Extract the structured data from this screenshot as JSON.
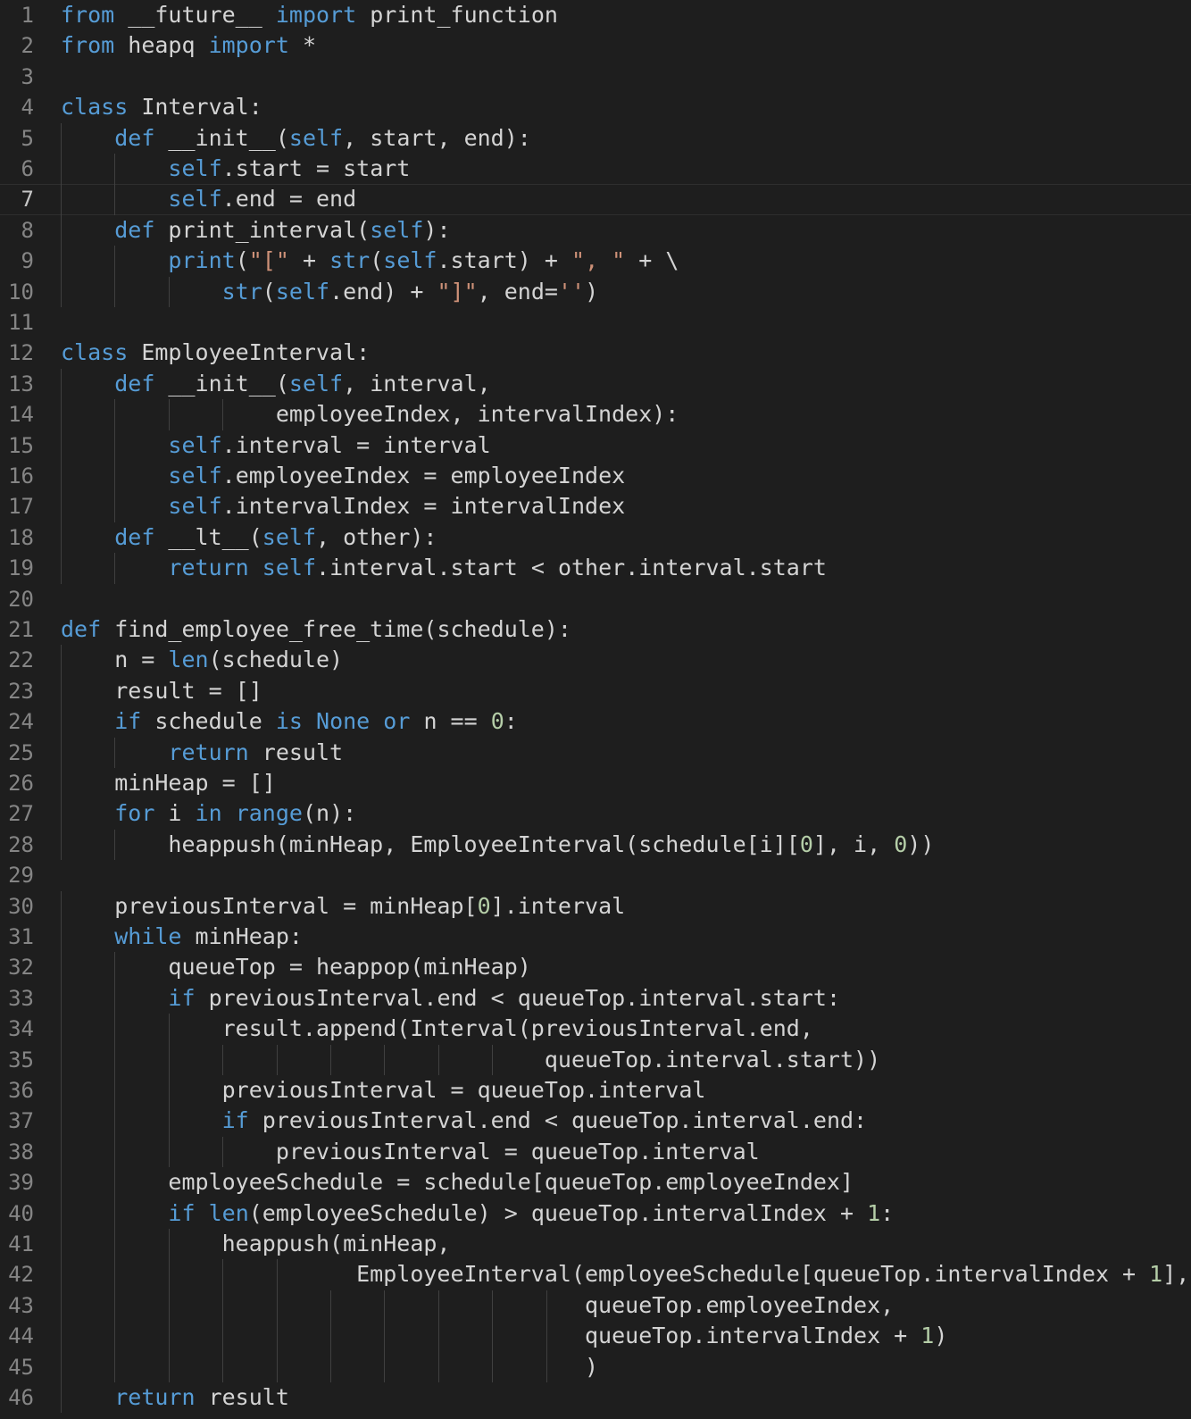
{
  "editor": {
    "language": "python",
    "current_line": 7,
    "colors": {
      "background": "#1e1e1e",
      "line_number": "#858585",
      "keyword": "#569cd6",
      "builtin": "#569cd6",
      "string": "#ce9178",
      "number": "#b5cea8",
      "text": "#d4d4d4",
      "indent_guide": "#404040"
    },
    "lines": [
      {
        "n": "1",
        "indent": 0,
        "tokens": [
          [
            "kw",
            "from"
          ],
          [
            "df",
            " __future__ "
          ],
          [
            "kw",
            "import"
          ],
          [
            "df",
            " print_function"
          ]
        ]
      },
      {
        "n": "2",
        "indent": 0,
        "tokens": [
          [
            "kw",
            "from"
          ],
          [
            "df",
            " heapq "
          ],
          [
            "kw",
            "import"
          ],
          [
            "df",
            " *"
          ]
        ]
      },
      {
        "n": "3",
        "indent": 0,
        "tokens": []
      },
      {
        "n": "4",
        "indent": 0,
        "tokens": [
          [
            "kw",
            "class"
          ],
          [
            "df",
            " Interval:"
          ]
        ]
      },
      {
        "n": "5",
        "indent": 1,
        "tokens": [
          [
            "df",
            "    "
          ],
          [
            "kw",
            "def"
          ],
          [
            "df",
            " __init__("
          ],
          [
            "kw",
            "self"
          ],
          [
            "df",
            ", start, end):"
          ]
        ]
      },
      {
        "n": "6",
        "indent": 2,
        "tokens": [
          [
            "df",
            "        "
          ],
          [
            "kw",
            "self"
          ],
          [
            "df",
            ".start = start"
          ]
        ]
      },
      {
        "n": "7",
        "indent": 2,
        "tokens": [
          [
            "df",
            "        "
          ],
          [
            "kw",
            "self"
          ],
          [
            "df",
            ".end = end"
          ]
        ]
      },
      {
        "n": "8",
        "indent": 1,
        "tokens": [
          [
            "df",
            "    "
          ],
          [
            "kw",
            "def"
          ],
          [
            "df",
            " print_interval("
          ],
          [
            "kw",
            "self"
          ],
          [
            "df",
            "):"
          ]
        ]
      },
      {
        "n": "9",
        "indent": 2,
        "tokens": [
          [
            "df",
            "        "
          ],
          [
            "kw",
            "print"
          ],
          [
            "df",
            "("
          ],
          [
            "st",
            "\"[\""
          ],
          [
            "df",
            " + "
          ],
          [
            "kw",
            "str"
          ],
          [
            "df",
            "("
          ],
          [
            "kw",
            "self"
          ],
          [
            "df",
            ".start) + "
          ],
          [
            "st",
            "\", \""
          ],
          [
            "df",
            " + \\"
          ]
        ]
      },
      {
        "n": "10",
        "indent": 3,
        "tokens": [
          [
            "df",
            "            "
          ],
          [
            "kw",
            "str"
          ],
          [
            "df",
            "("
          ],
          [
            "kw",
            "self"
          ],
          [
            "df",
            ".end) + "
          ],
          [
            "st",
            "\"]\""
          ],
          [
            "df",
            ", end="
          ],
          [
            "st",
            "''"
          ],
          [
            "df",
            ")"
          ]
        ]
      },
      {
        "n": "11",
        "indent": 0,
        "tokens": []
      },
      {
        "n": "12",
        "indent": 0,
        "tokens": [
          [
            "kw",
            "class"
          ],
          [
            "df",
            " EmployeeInterval:"
          ]
        ]
      },
      {
        "n": "13",
        "indent": 1,
        "tokens": [
          [
            "df",
            "    "
          ],
          [
            "kw",
            "def"
          ],
          [
            "df",
            " __init__("
          ],
          [
            "kw",
            "self"
          ],
          [
            "df",
            ", interval,"
          ]
        ]
      },
      {
        "n": "14",
        "indent": 4,
        "tokens": [
          [
            "df",
            "                employeeIndex, intervalIndex):"
          ]
        ]
      },
      {
        "n": "15",
        "indent": 2,
        "tokens": [
          [
            "df",
            "        "
          ],
          [
            "kw",
            "self"
          ],
          [
            "df",
            ".interval = interval"
          ]
        ]
      },
      {
        "n": "16",
        "indent": 2,
        "tokens": [
          [
            "df",
            "        "
          ],
          [
            "kw",
            "self"
          ],
          [
            "df",
            ".employeeIndex = employeeIndex"
          ]
        ]
      },
      {
        "n": "17",
        "indent": 2,
        "tokens": [
          [
            "df",
            "        "
          ],
          [
            "kw",
            "self"
          ],
          [
            "df",
            ".intervalIndex = intervalIndex"
          ]
        ]
      },
      {
        "n": "18",
        "indent": 1,
        "tokens": [
          [
            "df",
            "    "
          ],
          [
            "kw",
            "def"
          ],
          [
            "df",
            " __lt__("
          ],
          [
            "kw",
            "self"
          ],
          [
            "df",
            ", other):"
          ]
        ]
      },
      {
        "n": "19",
        "indent": 2,
        "tokens": [
          [
            "df",
            "        "
          ],
          [
            "kw",
            "return"
          ],
          [
            "df",
            " "
          ],
          [
            "kw",
            "self"
          ],
          [
            "df",
            ".interval.start < other.interval.start"
          ]
        ]
      },
      {
        "n": "20",
        "indent": 0,
        "tokens": []
      },
      {
        "n": "21",
        "indent": 0,
        "tokens": [
          [
            "kw",
            "def"
          ],
          [
            "df",
            " find_employee_free_time(schedule):"
          ]
        ]
      },
      {
        "n": "22",
        "indent": 1,
        "tokens": [
          [
            "df",
            "    n = "
          ],
          [
            "kw",
            "len"
          ],
          [
            "df",
            "(schedule)"
          ]
        ]
      },
      {
        "n": "23",
        "indent": 1,
        "tokens": [
          [
            "df",
            "    result = []"
          ]
        ]
      },
      {
        "n": "24",
        "indent": 1,
        "tokens": [
          [
            "df",
            "    "
          ],
          [
            "kw",
            "if"
          ],
          [
            "df",
            " schedule "
          ],
          [
            "kw",
            "is"
          ],
          [
            "df",
            " "
          ],
          [
            "kw",
            "None"
          ],
          [
            "df",
            " "
          ],
          [
            "kw",
            "or"
          ],
          [
            "df",
            " n == "
          ],
          [
            "nm",
            "0"
          ],
          [
            "df",
            ":"
          ]
        ]
      },
      {
        "n": "25",
        "indent": 2,
        "tokens": [
          [
            "df",
            "        "
          ],
          [
            "kw",
            "return"
          ],
          [
            "df",
            " result"
          ]
        ]
      },
      {
        "n": "26",
        "indent": 1,
        "tokens": [
          [
            "df",
            "    minHeap = []"
          ]
        ]
      },
      {
        "n": "27",
        "indent": 1,
        "tokens": [
          [
            "df",
            "    "
          ],
          [
            "kw",
            "for"
          ],
          [
            "df",
            " i "
          ],
          [
            "kw",
            "in"
          ],
          [
            "df",
            " "
          ],
          [
            "kw",
            "range"
          ],
          [
            "df",
            "(n):"
          ]
        ]
      },
      {
        "n": "28",
        "indent": 2,
        "tokens": [
          [
            "df",
            "        heappush(minHeap, EmployeeInterval(schedule[i]["
          ],
          [
            "nm",
            "0"
          ],
          [
            "df",
            "], i, "
          ],
          [
            "nm",
            "0"
          ],
          [
            "df",
            "))"
          ]
        ]
      },
      {
        "n": "29",
        "indent": 0,
        "tokens": []
      },
      {
        "n": "30",
        "indent": 1,
        "tokens": [
          [
            "df",
            "    previousInterval = minHeap["
          ],
          [
            "nm",
            "0"
          ],
          [
            "df",
            "].interval"
          ]
        ]
      },
      {
        "n": "31",
        "indent": 1,
        "tokens": [
          [
            "df",
            "    "
          ],
          [
            "kw",
            "while"
          ],
          [
            "df",
            " minHeap:"
          ]
        ]
      },
      {
        "n": "32",
        "indent": 2,
        "tokens": [
          [
            "df",
            "        queueTop = heappop(minHeap)"
          ]
        ]
      },
      {
        "n": "33",
        "indent": 2,
        "tokens": [
          [
            "df",
            "        "
          ],
          [
            "kw",
            "if"
          ],
          [
            "df",
            " previousInterval.end < queueTop.interval.start:"
          ]
        ]
      },
      {
        "n": "34",
        "indent": 3,
        "tokens": [
          [
            "df",
            "            result.append(Interval(previousInterval.end,"
          ]
        ]
      },
      {
        "n": "35",
        "indent": 9,
        "tokens": [
          [
            "df",
            "                                    queueTop.interval.start))"
          ]
        ]
      },
      {
        "n": "36",
        "indent": 3,
        "tokens": [
          [
            "df",
            "            previousInterval = queueTop.interval"
          ]
        ]
      },
      {
        "n": "37",
        "indent": 3,
        "tokens": [
          [
            "df",
            "            "
          ],
          [
            "kw",
            "if"
          ],
          [
            "df",
            " previousInterval.end < queueTop.interval.end:"
          ]
        ]
      },
      {
        "n": "38",
        "indent": 4,
        "tokens": [
          [
            "df",
            "                previousInterval = queueTop.interval"
          ]
        ]
      },
      {
        "n": "39",
        "indent": 2,
        "tokens": [
          [
            "df",
            "        employeeSchedule = schedule[queueTop.employeeIndex]"
          ]
        ]
      },
      {
        "n": "40",
        "indent": 2,
        "tokens": [
          [
            "df",
            "        "
          ],
          [
            "kw",
            "if"
          ],
          [
            "df",
            " "
          ],
          [
            "kw",
            "len"
          ],
          [
            "df",
            "(employeeSchedule) > queueTop.intervalIndex + "
          ],
          [
            "nm",
            "1"
          ],
          [
            "df",
            ":"
          ]
        ]
      },
      {
        "n": "41",
        "indent": 3,
        "tokens": [
          [
            "df",
            "            heappush(minHeap,"
          ]
        ]
      },
      {
        "n": "42",
        "indent": 5,
        "tokens": [
          [
            "df",
            "                      EmployeeInterval(employeeSchedule[queueTop.intervalIndex + "
          ],
          [
            "nm",
            "1"
          ],
          [
            "df",
            "],"
          ]
        ]
      },
      {
        "n": "43",
        "indent": 10,
        "tokens": [
          [
            "df",
            "                                       queueTop.employeeIndex,"
          ]
        ]
      },
      {
        "n": "44",
        "indent": 10,
        "tokens": [
          [
            "df",
            "                                       queueTop.intervalIndex + "
          ],
          [
            "nm",
            "1"
          ],
          [
            "df",
            ")"
          ]
        ]
      },
      {
        "n": "45",
        "indent": 10,
        "tokens": [
          [
            "df",
            "                                       )"
          ]
        ]
      },
      {
        "n": "46",
        "indent": 1,
        "tokens": [
          [
            "df",
            "    "
          ],
          [
            "kw",
            "return"
          ],
          [
            "df",
            " result"
          ]
        ]
      }
    ]
  }
}
